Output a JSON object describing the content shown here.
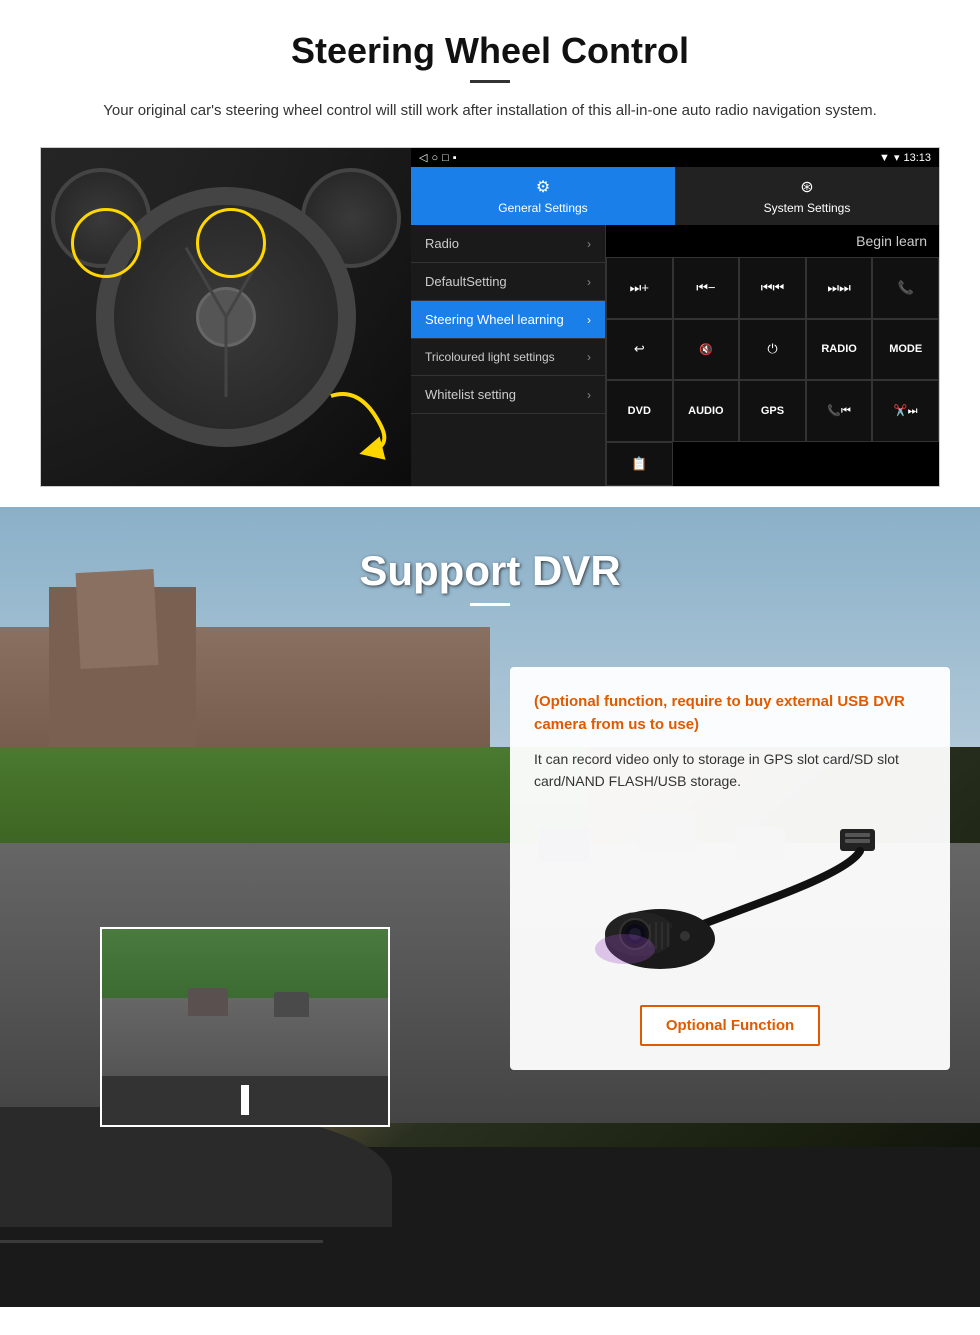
{
  "steering": {
    "title": "Steering Wheel Control",
    "subtitle": "Your original car's steering wheel control will still work after installation of this all-in-one auto radio navigation system.",
    "statusbar": {
      "time": "13:13",
      "icons": "▼ ▾"
    },
    "tabs": [
      {
        "label": "General Settings",
        "icon": "⚙",
        "active": true
      },
      {
        "label": "System Settings",
        "icon": "🌐",
        "active": false
      }
    ],
    "menu_items": [
      {
        "label": "Radio",
        "active": false
      },
      {
        "label": "DefaultSetting",
        "active": false
      },
      {
        "label": "Steering Wheel learning",
        "active": true
      },
      {
        "label": "Tricoloured light settings",
        "active": false
      },
      {
        "label": "Whitelist setting",
        "active": false
      }
    ],
    "begin_learn": "Begin learn",
    "control_buttons": [
      "⏭+",
      "⏮−",
      "⏮⏮",
      "⏭⏭",
      "📞",
      "↩",
      "🔇",
      "⏻",
      "RADIO",
      "MODE",
      "DVD",
      "AUDIO",
      "GPS",
      "📞⏮",
      "✂️⏭"
    ],
    "extra_btn": "📋"
  },
  "dvr": {
    "title": "Support DVR",
    "optional_text": "(Optional function, require to buy external USB DVR camera from us to use)",
    "description": "It can record video only to storage in GPS slot card/SD slot card/NAND FLASH/USB storage.",
    "optional_function_label": "Optional Function"
  }
}
